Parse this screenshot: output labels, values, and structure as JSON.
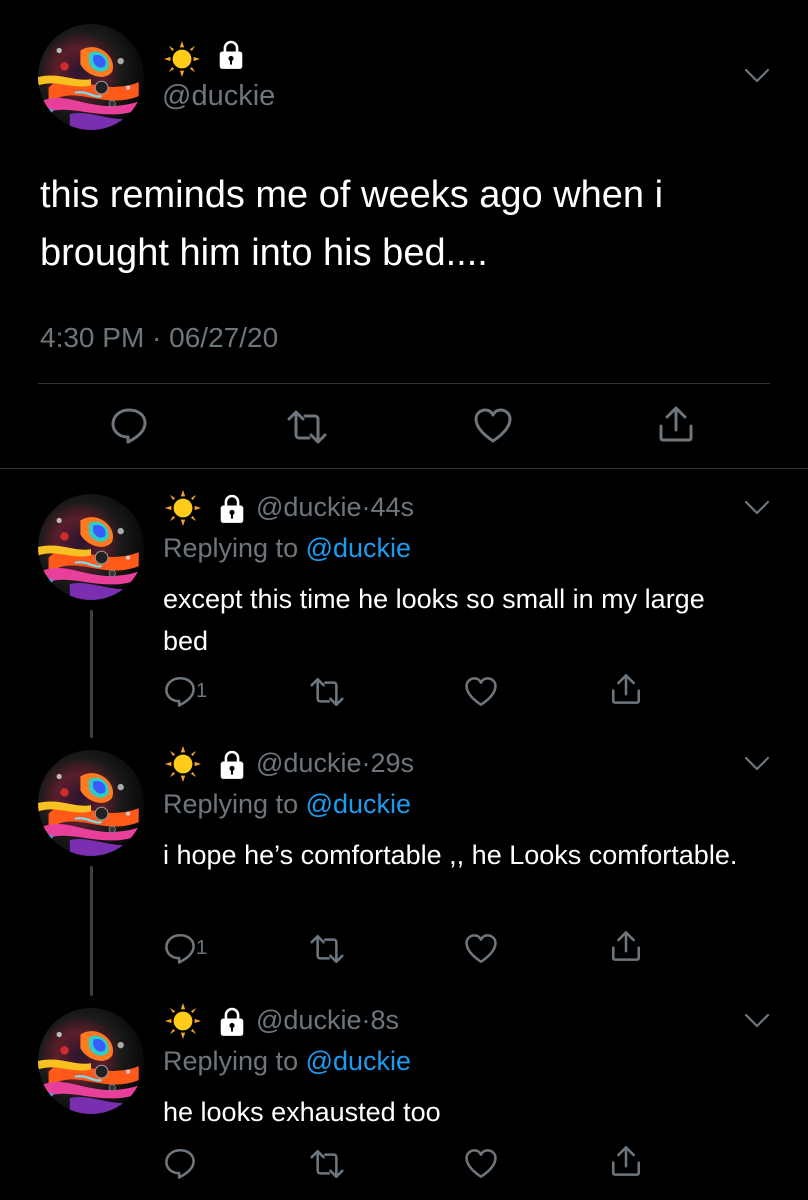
{
  "main_tweet": {
    "handle": "@duckie",
    "text": "this reminds me of weeks ago when i brought him into his bed....",
    "timestamp": "4:30 PM · 06/27/20"
  },
  "replies": [
    {
      "handle": "@duckie",
      "sep": "·",
      "time": "44s",
      "replying_prefix": "Replying to",
      "replying_handle": "@duckie",
      "text": "except this time he looks so small in my large bed",
      "reply_count": "1"
    },
    {
      "handle": "@duckie",
      "sep": "·",
      "time": "29s",
      "replying_prefix": "Replying to",
      "replying_handle": "@duckie",
      "text": "i hope he’s comfortable ,, he Looks comfortable.",
      "reply_count": "1"
    },
    {
      "handle": "@duckie",
      "sep": "·",
      "time": "8s",
      "replying_prefix": "Replying to",
      "replying_handle": "@duckie",
      "text": "he looks exhausted too",
      "reply_count": ""
    }
  ],
  "icons": {
    "name_emoji": "sun-icon",
    "protected": "lock-icon",
    "reply": "reply-icon",
    "retweet": "retweet-icon",
    "like": "heart-icon",
    "share": "share-icon",
    "menu": "chevron-down-icon"
  },
  "colors": {
    "background": "#000000",
    "text": "#ffffff",
    "secondary": "#6e767d",
    "link": "#1d9bf0",
    "divider": "#2f3336"
  }
}
